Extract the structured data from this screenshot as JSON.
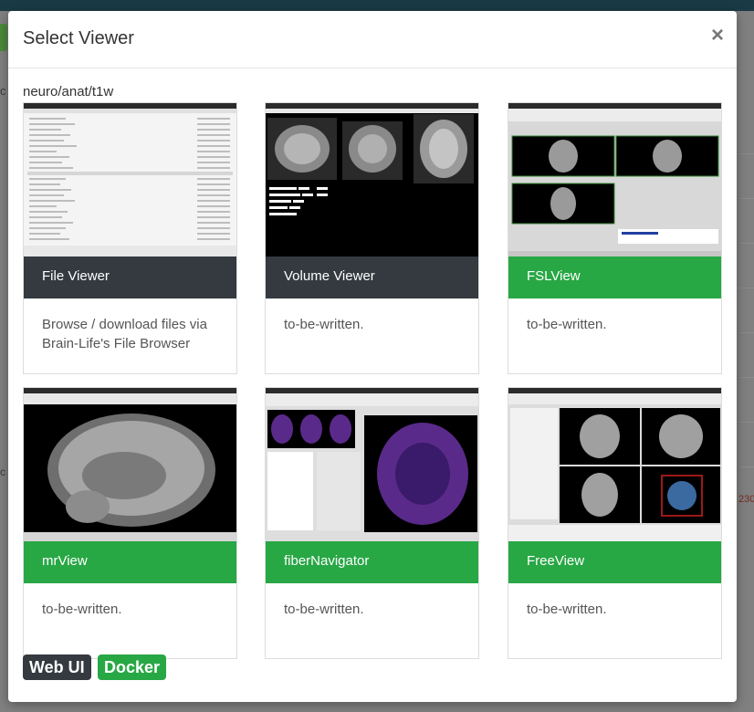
{
  "modal": {
    "title": "Select Viewer",
    "close_label": "×",
    "path": "neuro/anat/t1w"
  },
  "viewers": [
    {
      "name": "File Viewer",
      "desc": "Browse / download files via Brain-Life's File Browser",
      "header_color": "#343a40"
    },
    {
      "name": "Volume Viewer",
      "desc": "to-be-written.",
      "header_color": "#343a40"
    },
    {
      "name": "FSLView",
      "desc": "to-be-written.",
      "header_color": "#28a745"
    },
    {
      "name": "mrView",
      "desc": "to-be-written.",
      "header_color": "#28a745"
    },
    {
      "name": "fiberNavigator",
      "desc": "to-be-written.",
      "header_color": "#28a745"
    },
    {
      "name": "FreeView",
      "desc": "to-be-written.",
      "header_color": "#28a745"
    }
  ],
  "badges": [
    {
      "label": "Web UI",
      "color": "#343a40"
    },
    {
      "label": "Docker",
      "color": "#28a745"
    }
  ],
  "background": {
    "edge_text": "2308"
  }
}
